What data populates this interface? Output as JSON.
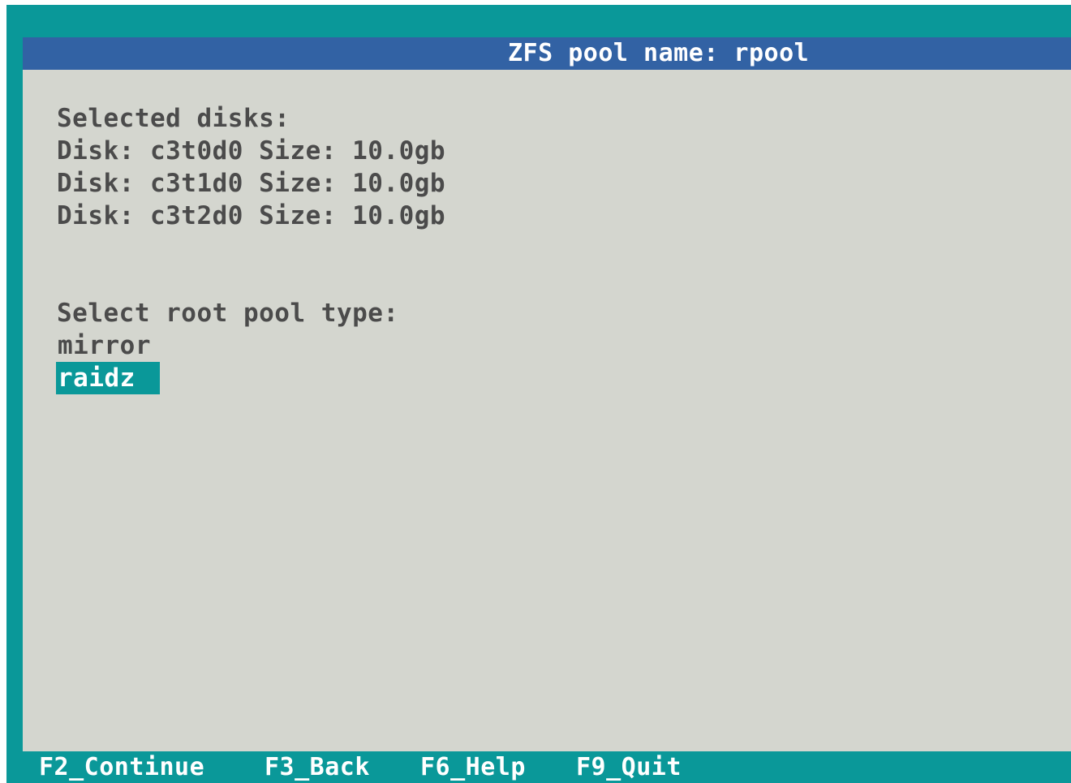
{
  "header": {
    "title": "ZFS pool name: rpool"
  },
  "disks": {
    "heading": "Selected disks:",
    "items": [
      {
        "line": "Disk: c3t0d0 Size: 10.0gb"
      },
      {
        "line": "Disk: c3t1d0 Size: 10.0gb"
      },
      {
        "line": "Disk: c3t2d0 Size: 10.0gb"
      }
    ]
  },
  "pool_type": {
    "heading": "Select root pool type:",
    "options": [
      {
        "label": "mirror",
        "selected": false
      },
      {
        "label": "raidz",
        "selected": true
      }
    ]
  },
  "footer": {
    "keys": [
      {
        "label": "F2_Continue"
      },
      {
        "label": "F3_Back"
      },
      {
        "label": "F6_Help"
      },
      {
        "label": "F9_Quit"
      }
    ]
  },
  "colors": {
    "background": "#0a9899",
    "panel": "#d4d6cf",
    "titlebar": "#3262a4",
    "highlight": "#0a9899",
    "text": "#4b4b4b"
  }
}
